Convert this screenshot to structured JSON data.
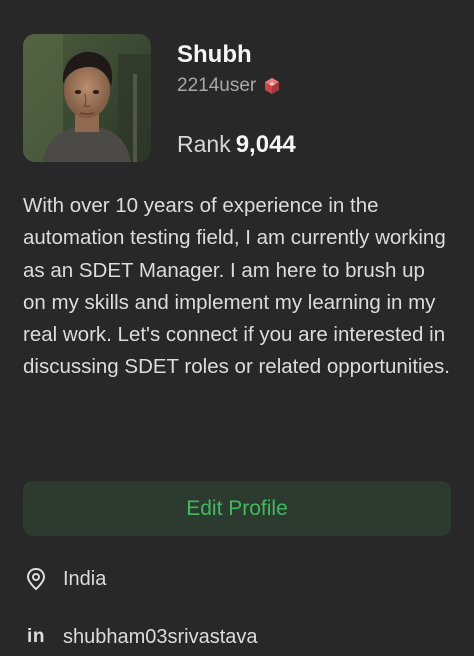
{
  "profile": {
    "name": "Shubh",
    "username": "2214user",
    "rank_label": "Rank",
    "rank_value": "9,044",
    "bio": "With over 10 years of experience in the automation testing field, I am currently working as an SDET Manager. I am here to brush up on my skills and implement my learning in my real work. Let's connect if you are interested in discussing SDET roles or related opportunities.",
    "edit_button_label": "Edit Profile"
  },
  "details": {
    "location": "India",
    "linkedin": "shubham03srivastava",
    "linkedin_glyph": "in"
  },
  "icons": {
    "badge": "cube-badge-icon",
    "location": "location-pin-icon",
    "linkedin": "linkedin-icon"
  },
  "colors": {
    "background": "#282828",
    "accent_green": "#3fba5e",
    "button_bg": "#2c3a2f",
    "badge_red": "#d9534f"
  }
}
